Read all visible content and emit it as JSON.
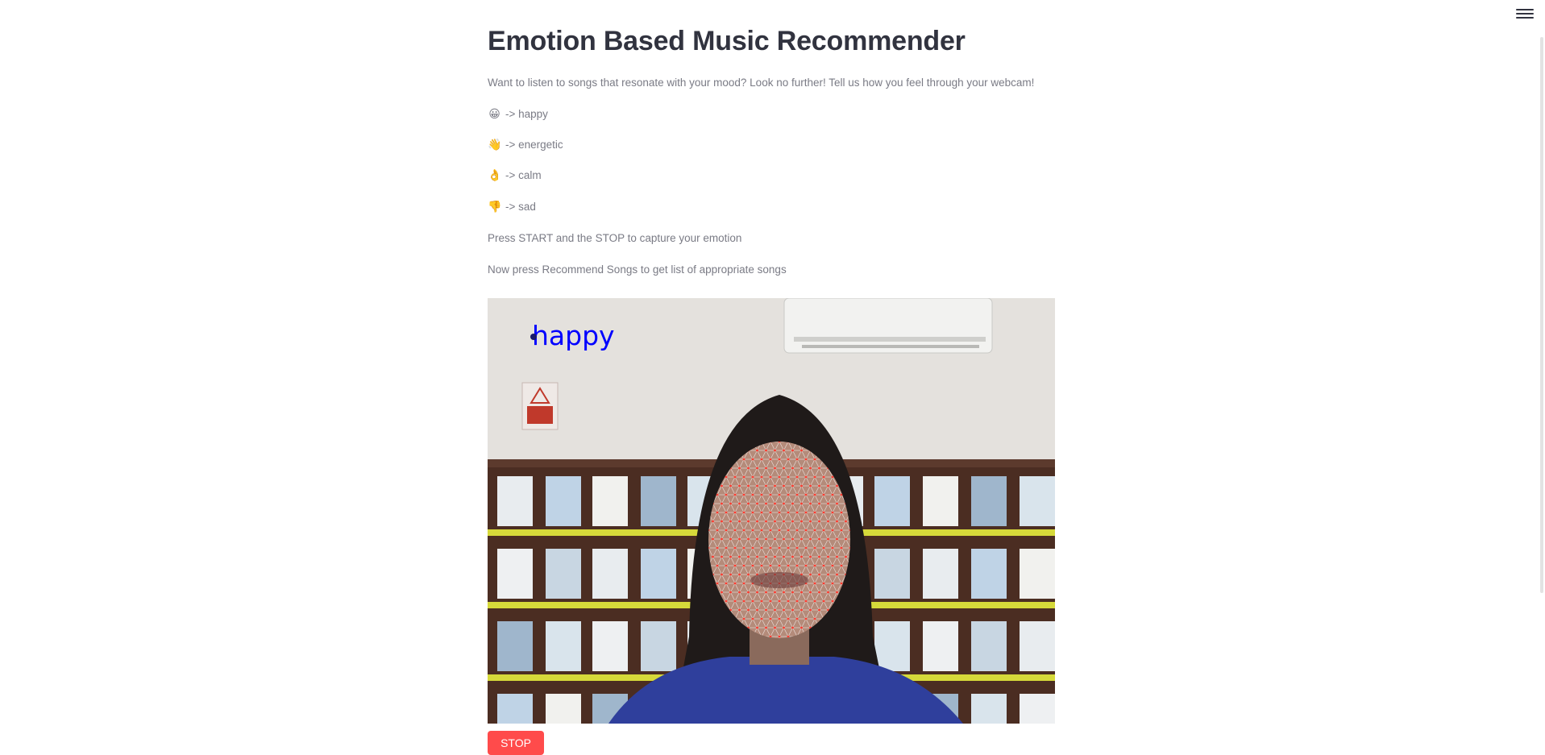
{
  "app": {
    "title": "Emotion Based Music Recommender",
    "intro": "Want to listen to songs that resonate with your mood? Look no further! Tell us how you feel through your webcam!"
  },
  "legend": [
    {
      "emoji": "😀",
      "label": "-> happy",
      "icon": "grinning-face-icon"
    },
    {
      "emoji": "👋",
      "label": "-> energetic",
      "icon": "waving-hand-icon"
    },
    {
      "emoji": "👌",
      "label": "-> calm",
      "icon": "ok-hand-icon"
    },
    {
      "emoji": "👎",
      "label": "-> sad",
      "icon": "thumbs-down-icon"
    }
  ],
  "instructions": {
    "capture": "Press START and the STOP to capture your emotion",
    "recommend": "Now press Recommend Songs to get list of appropriate songs"
  },
  "webcam": {
    "detected_emotion": "happy",
    "overlay_color": "#0000ff",
    "mesh_color": "#ff3b30"
  },
  "controls": {
    "stop_label": "STOP",
    "stop_color": "#ff4b4b"
  },
  "menu": {
    "icon": "hamburger-menu-icon"
  }
}
